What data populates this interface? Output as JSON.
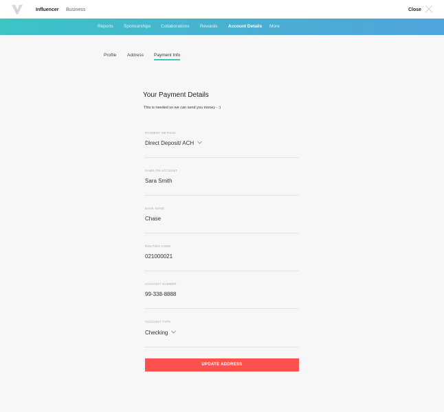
{
  "header": {
    "tabs": [
      "Influencer",
      "Business"
    ],
    "close_label": "Close"
  },
  "nav": {
    "items": [
      "Reports",
      "Sponsorships",
      "Collaborations",
      "Rewards",
      "Account Details",
      "More"
    ],
    "active": "Account Details"
  },
  "subtabs": {
    "items": [
      "Profile",
      "Address",
      "Payment Info"
    ],
    "active": "Payment Info"
  },
  "form": {
    "title": "Your Payment Details",
    "subtitle": "This is needed so we can send you money - :)",
    "fields": [
      {
        "label": "PAYMENT METHOD",
        "value": "Direct Deposit/ ACH",
        "dropdown": true
      },
      {
        "label": "NAME ON ACCOUNT",
        "value": "Sara Smith",
        "dropdown": false
      },
      {
        "label": "BANK NAME",
        "value": "Chase",
        "dropdown": false
      },
      {
        "label": "ROUTING CODE",
        "value": "021000021",
        "dropdown": false
      },
      {
        "label": "ACCOUNT NUMBER",
        "value": "99-338-8888",
        "dropdown": false
      },
      {
        "label": "ACCOUNT TYPE",
        "value": "Checking",
        "dropdown": true
      }
    ],
    "submit_label": "UPDATE ADDRESS"
  },
  "colors": {
    "nav_gradient_start": "#3cc4c6",
    "nav_gradient_end": "#51a3dc",
    "accent": "#3cc4c6",
    "button": "#fb524f"
  },
  "icons": {
    "logo": "v-logo-icon",
    "close": "close-icon",
    "dropdown": "chevron-down-icon"
  }
}
